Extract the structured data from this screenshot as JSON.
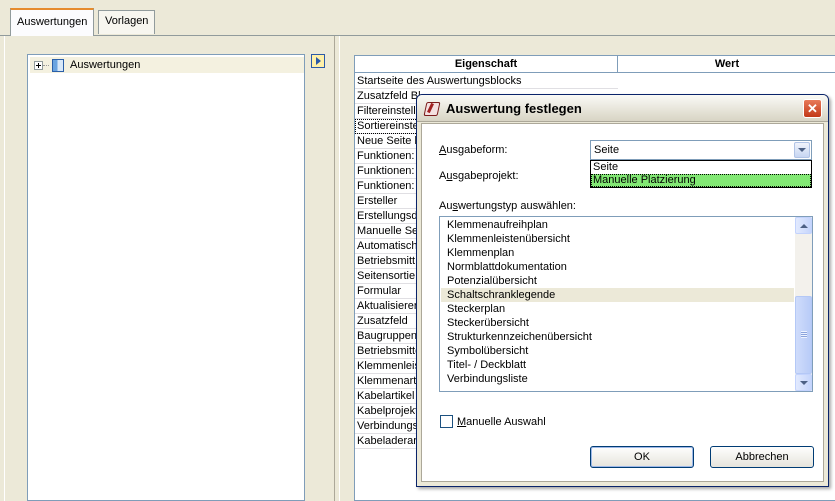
{
  "tabs": [
    {
      "label": "Auswertungen",
      "active": true
    },
    {
      "label": "Vorlagen",
      "active": false
    }
  ],
  "tree": {
    "root_label": "Auswertungen"
  },
  "grid": {
    "col_property": "Eigenschaft",
    "col_value": "Wert",
    "rows": [
      "Startseite des Auswertungsblocks",
      "Zusatzfeld Bl",
      "Filtereinstell",
      "Sortiereinste",
      "Neue Seite b",
      "Funktionen:",
      "Funktionen:",
      "Funktionen:",
      "Ersteller",
      "Erstellungsd",
      "Manuelle Sei",
      "Automatisch",
      "Betriebsmitt",
      "Seitensortie",
      "Formular",
      "Aktualisierer",
      "Zusatzfeld",
      "Baugruppen",
      "Betriebsmitte",
      "Klemmenleist",
      "Klemmenarti",
      "Kabelartikel",
      "Kabelprojekt",
      "Verbindungs",
      "Kabeladerar"
    ]
  },
  "dialog": {
    "title": "Auswertung festlegen",
    "close_glyph": "✕",
    "ausgabeform_label_u": "A",
    "ausgabeform_label_rest": "usgabeform:",
    "ausgabeform_value": "Seite",
    "ausgabeform_options": [
      "Seite",
      "Manuelle Platzierung"
    ],
    "ausgabeprojekt_label_pre": "A",
    "ausgabeprojekt_label_u": "u",
    "ausgabeprojekt_label_rest": "sgabeprojekt:",
    "typ_label_pre": "Au",
    "typ_label_u": "s",
    "typ_label_rest": "wertungstyp auswählen:",
    "typ_items": [
      "Klemmenaufreihplan",
      "Klemmenleistenübersicht",
      "Klemmenplan",
      "Normblattdokumentation",
      "Potenzialübersicht",
      "Schaltschranklegende",
      "Steckerplan",
      "Steckerübersicht",
      "Strukturkennzeichenübersicht",
      "Symbolübersicht",
      "Titel- / Deckblatt",
      "Verbindungsliste"
    ],
    "typ_selected": "Schaltschranklegende",
    "manual_label_u": "M",
    "manual_label_rest": "anuelle Auswahl",
    "ok_label": "OK",
    "cancel_label": "Abbrechen"
  },
  "colors": {
    "selection_highlight": "#82e874",
    "title_close": "#c23818"
  }
}
